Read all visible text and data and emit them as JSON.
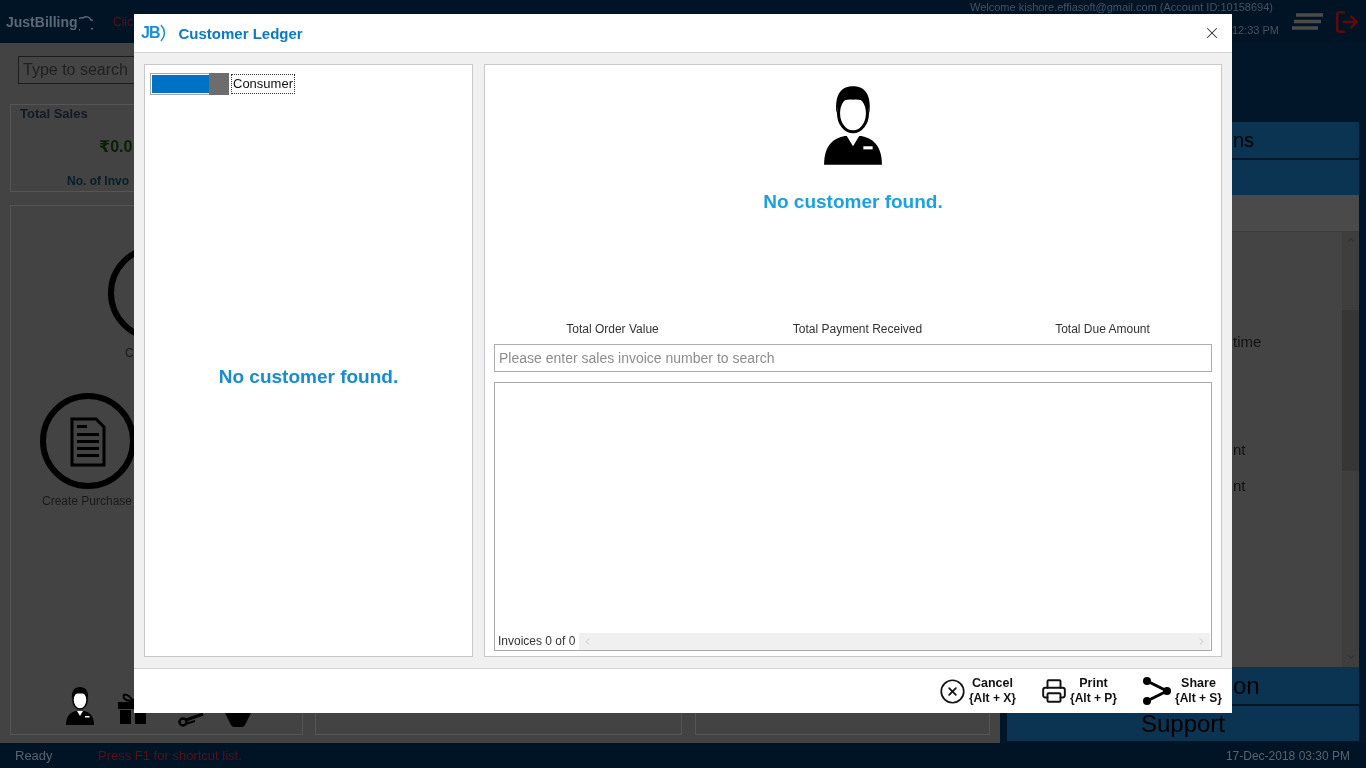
{
  "app": {
    "logo": "JustBilling",
    "notice": "Clic",
    "welcome": "Welcome kishore.effiasoft@gmail.com (Account ID:10158694)",
    "time": "12:33 PM"
  },
  "sidebar": {
    "search": {
      "placeholder": "Type to search"
    },
    "sales_card": {
      "title": "Total Sales",
      "amount": "₹0.0",
      "invoice_label": "No. of Invo"
    },
    "actions": [
      {
        "kind": "ring",
        "label": "C"
      },
      {
        "kind": "document",
        "label": "Create Purchase"
      }
    ]
  },
  "right_panel": {
    "header": "ns",
    "list_items": [
      "time",
      "nt",
      "nt"
    ],
    "sections": [
      "on",
      "Support"
    ]
  },
  "dialog": {
    "logo": "JB",
    "title": "Customer Ledger",
    "customer_type": {
      "label": "Consumer",
      "on": true
    },
    "customer_list_message": "No customer found.",
    "detail_message": "No customer found.",
    "summary": [
      "Total Order Value",
      "Total Payment Received",
      "Total Due Amount"
    ],
    "invoice_search": {
      "placeholder": "Please enter sales invoice number to search"
    },
    "invoice_count": "Invoices 0 of 0",
    "buttons": [
      {
        "kind": "cancel",
        "label": "Cancel",
        "shortcut": "{Alt + X}"
      },
      {
        "kind": "print",
        "label": "Print",
        "shortcut": "{Alt + P}"
      },
      {
        "kind": "share",
        "label": "Share",
        "shortcut": "{Alt + S}"
      }
    ]
  },
  "status_bar": {
    "status": "Ready",
    "hint": "Press F1 for shortcut list.",
    "datetime": "17-Dec-2018 03:30 PM"
  }
}
